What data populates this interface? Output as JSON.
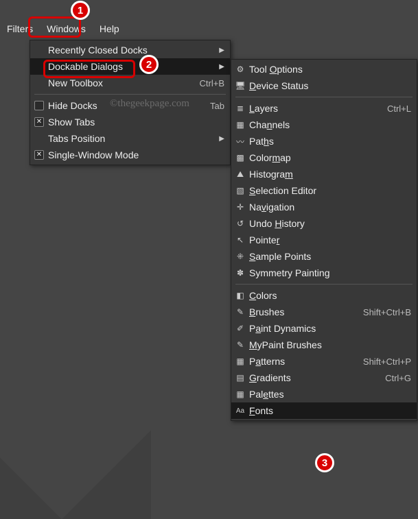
{
  "menubar": {
    "filters": "Filters",
    "windows": "Windows",
    "help": "Help"
  },
  "annotations": {
    "b1": "1",
    "b2": "2",
    "b3": "3"
  },
  "watermark": "©thegeekpage.com",
  "menu1": {
    "recently_closed": "Recently Closed Docks",
    "dockable": "Dockable Dialogs",
    "new_toolbox": "New Toolbox",
    "new_toolbox_accel": "Ctrl+B",
    "hide_docks": "Hide Docks",
    "hide_docks_accel": "Tab",
    "show_tabs": "Show Tabs",
    "tabs_position": "Tabs Position",
    "single_window": "Single-Window Mode"
  },
  "menu2": {
    "tool_options": {
      "pre": "Tool ",
      "u": "O",
      "post": "ptions"
    },
    "device_status": {
      "pre": "",
      "u": "D",
      "post": "evice Status"
    },
    "layers": {
      "pre": "",
      "u": "L",
      "post": "ayers"
    },
    "layers_accel": "Ctrl+L",
    "channels": {
      "pre": "Cha",
      "u": "n",
      "post": "nels"
    },
    "paths": {
      "pre": "Pat",
      "u": "h",
      "post": "s"
    },
    "colormap": {
      "pre": "Color",
      "u": "m",
      "post": "ap"
    },
    "histogram": {
      "pre": "Histogra",
      "u": "m",
      "post": ""
    },
    "selection_editor": {
      "pre": "",
      "u": "S",
      "post": "election Editor"
    },
    "navigation": {
      "pre": "Na",
      "u": "v",
      "post": "igation"
    },
    "undo_history": {
      "pre": "Undo ",
      "u": "H",
      "post": "istory"
    },
    "pointer": {
      "pre": "Pointe",
      "u": "r",
      "post": ""
    },
    "sample_points": {
      "pre": "",
      "u": "S",
      "post": "ample Points"
    },
    "symmetry_painting": "Symmetry Painting",
    "colors": {
      "pre": "",
      "u": "C",
      "post": "olors"
    },
    "brushes": {
      "pre": "",
      "u": "B",
      "post": "rushes"
    },
    "brushes_accel": "Shift+Ctrl+B",
    "paint_dynamics": {
      "pre": "P",
      "u": "a",
      "post": "int Dynamics"
    },
    "mypaint": {
      "pre": "",
      "u": "M",
      "post": "yPaint Brushes"
    },
    "patterns": {
      "pre": "P",
      "u": "a",
      "post": "tterns"
    },
    "patterns_accel": "Shift+Ctrl+P",
    "gradients": {
      "pre": "",
      "u": "G",
      "post": "radients"
    },
    "gradients_accel": "Ctrl+G",
    "palettes": {
      "pre": "Pal",
      "u": "e",
      "post": "ttes"
    },
    "fonts": {
      "pre": "",
      "u": "F",
      "post": "onts"
    }
  }
}
